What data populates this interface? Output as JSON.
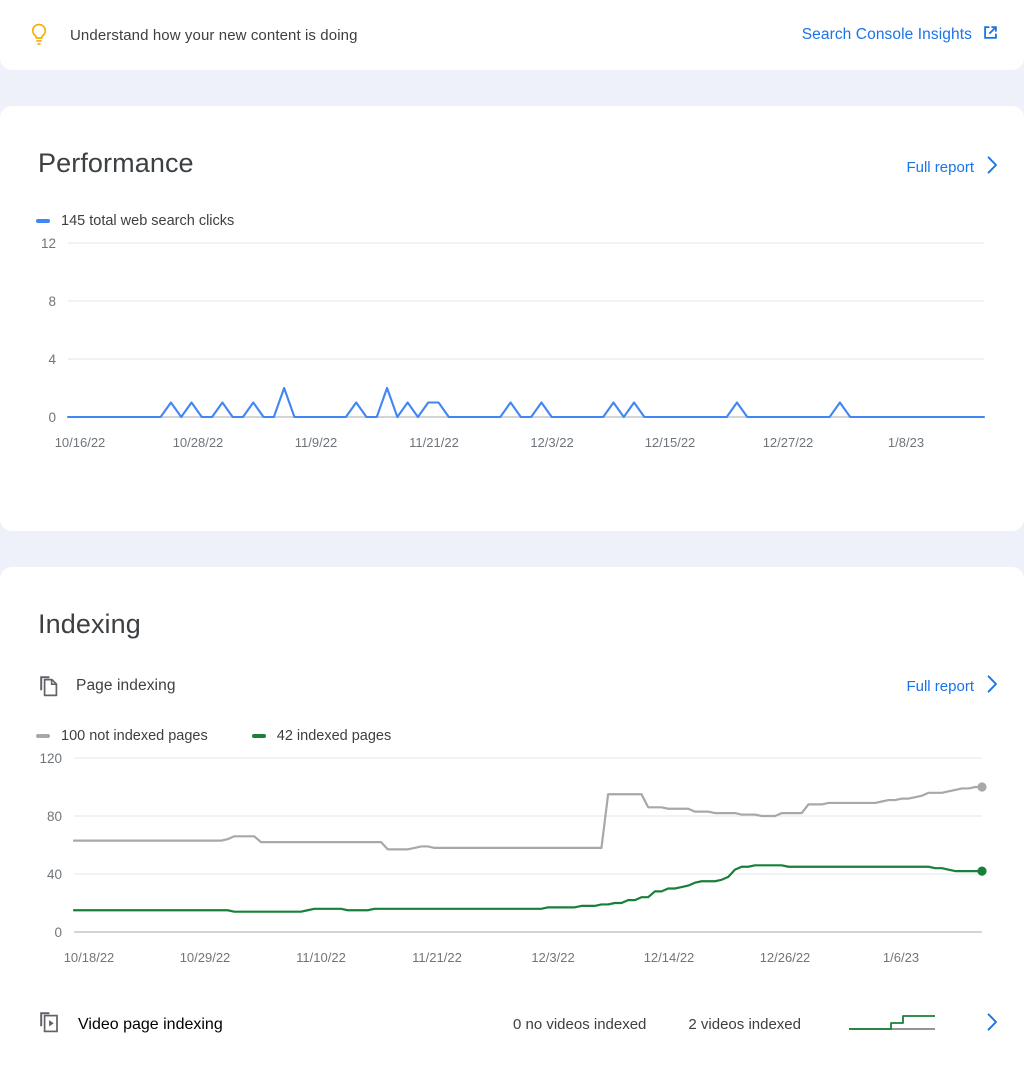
{
  "banner": {
    "icon": "lightbulb-icon",
    "text": "Understand how your new content is doing",
    "link_label": "Search Console Insights",
    "link_icon": "open-in-new-icon",
    "icon_color": "#f9ab00",
    "link_color": "#1a73e8"
  },
  "performance": {
    "title": "Performance",
    "full_report_label": "Full report",
    "legend": [
      {
        "label": "145 total web search clicks",
        "color": "#4285f4"
      }
    ],
    "chart_data": {
      "type": "line",
      "title": "145 total web search clicks",
      "xlabel": "",
      "ylabel": "",
      "ylim": [
        0,
        12
      ],
      "yticks": [
        0,
        4,
        8,
        12
      ],
      "grid": true,
      "legend_position": "top-left",
      "line_color": "#4285f4",
      "tick_labels": [
        "10/16/22",
        "10/28/22",
        "11/9/22",
        "11/21/22",
        "12/3/22",
        "12/15/22",
        "12/27/22",
        "1/8/23"
      ],
      "tick_indices": [
        0,
        12,
        24,
        36,
        48,
        60,
        72,
        84
      ],
      "x_start": "10/16/22",
      "x_end": "1/14/23",
      "series": [
        {
          "name": "web search clicks",
          "values": [
            0,
            0,
            0,
            0,
            0,
            0,
            0,
            0,
            0,
            0,
            1,
            0,
            1,
            0,
            0,
            1,
            0,
            0,
            1,
            0,
            0,
            2,
            0,
            0,
            0,
            0,
            0,
            0,
            1,
            0,
            0,
            2,
            0,
            1,
            0,
            1,
            1,
            0,
            0,
            0,
            0,
            0,
            0,
            1,
            0,
            0,
            1,
            0,
            0,
            0,
            0,
            0,
            0,
            1,
            0,
            1,
            0,
            0,
            0,
            0,
            0,
            0,
            0,
            0,
            0,
            1,
            0,
            0,
            0,
            0,
            0,
            0,
            0,
            0,
            0,
            1,
            0,
            0,
            0,
            0,
            0,
            0,
            0,
            0,
            0,
            0,
            0,
            0,
            0,
            0
          ]
        }
      ]
    }
  },
  "indexing": {
    "title": "Indexing",
    "page_indexing": {
      "icon": "pages-copy-icon",
      "label": "Page indexing",
      "full_report_label": "Full report",
      "legend": [
        {
          "label": "100 not indexed pages",
          "color": "#a8a8a8"
        },
        {
          "label": "42 indexed pages",
          "color": "#188038"
        }
      ],
      "chart_data": {
        "type": "line",
        "title": "Page indexing",
        "xlabel": "",
        "ylabel": "",
        "ylim": [
          0,
          120
        ],
        "yticks": [
          0,
          40,
          80,
          120
        ],
        "grid": true,
        "legend_position": "top-left",
        "tick_labels": [
          "10/18/22",
          "10/29/22",
          "11/10/22",
          "11/21/22",
          "12/3/22",
          "12/14/22",
          "12/26/22",
          "1/6/23"
        ],
        "x_start": "10/18/22",
        "x_end": "1/16/23",
        "series": [
          {
            "name": "100 not indexed pages",
            "color": "#a8a8a8",
            "end_value": 100,
            "values": [
              63,
              63,
              63,
              63,
              63,
              63,
              63,
              63,
              63,
              63,
              63,
              63,
              63,
              63,
              63,
              63,
              63,
              63,
              63,
              63,
              63,
              63,
              63,
              64,
              66,
              66,
              66,
              66,
              62,
              62,
              62,
              62,
              62,
              62,
              62,
              62,
              62,
              62,
              62,
              62,
              62,
              62,
              62,
              62,
              62,
              62,
              62,
              57,
              57,
              57,
              57,
              58,
              59,
              59,
              58,
              58,
              58,
              58,
              58,
              58,
              58,
              58,
              58,
              58,
              58,
              58,
              58,
              58,
              58,
              58,
              58,
              58,
              58,
              58,
              58,
              58,
              58,
              58,
              58,
              58,
              95,
              95,
              95,
              95,
              95,
              95,
              86,
              86,
              86,
              85,
              85,
              85,
              85,
              83,
              83,
              83,
              82,
              82,
              82,
              82,
              81,
              81,
              81,
              80,
              80,
              80,
              82,
              82,
              82,
              82,
              88,
              88,
              88,
              89,
              89,
              89,
              89,
              89,
              89,
              89,
              89,
              90,
              91,
              91,
              92,
              92,
              93,
              94,
              96,
              96,
              96,
              97,
              98,
              99,
              99,
              100,
              100
            ]
          },
          {
            "name": "42 indexed pages",
            "color": "#188038",
            "end_value": 42,
            "values": [
              15,
              15,
              15,
              15,
              15,
              15,
              15,
              15,
              15,
              15,
              15,
              15,
              15,
              15,
              15,
              15,
              15,
              15,
              15,
              15,
              15,
              15,
              15,
              15,
              14,
              14,
              14,
              14,
              14,
              14,
              14,
              14,
              14,
              14,
              14,
              15,
              16,
              16,
              16,
              16,
              16,
              15,
              15,
              15,
              15,
              16,
              16,
              16,
              16,
              16,
              16,
              16,
              16,
              16,
              16,
              16,
              16,
              16,
              16,
              16,
              16,
              16,
              16,
              16,
              16,
              16,
              16,
              16,
              16,
              16,
              16,
              17,
              17,
              17,
              17,
              17,
              18,
              18,
              18,
              19,
              19,
              20,
              20,
              22,
              22,
              24,
              24,
              28,
              28,
              30,
              30,
              31,
              32,
              34,
              35,
              35,
              35,
              36,
              38,
              43,
              45,
              45,
              46,
              46,
              46,
              46,
              46,
              45,
              45,
              45,
              45,
              45,
              45,
              45,
              45,
              45,
              45,
              45,
              45,
              45,
              45,
              45,
              45,
              45,
              45,
              45,
              45,
              45,
              45,
              44,
              44,
              43,
              42,
              42,
              42,
              42,
              42
            ]
          }
        ]
      }
    },
    "video_indexing": {
      "icon": "video-page-icon",
      "label": "Video page indexing",
      "stat_no_videos": "0 no videos indexed",
      "stat_videos": "2 videos indexed",
      "sparkline_colors": {
        "not_indexed": "#80868b",
        "indexed": "#188038"
      }
    }
  },
  "colors": {
    "page_background": "#eef1fa",
    "card_background": "#ffffff",
    "text_primary": "#3c4043",
    "text_secondary": "#70757a",
    "blue": "#1a73e8",
    "chart_blue": "#4285f4",
    "chart_green": "#188038",
    "chart_gray": "#a8a8a8",
    "gridline": "#e8eaed",
    "amber": "#f9ab00"
  }
}
